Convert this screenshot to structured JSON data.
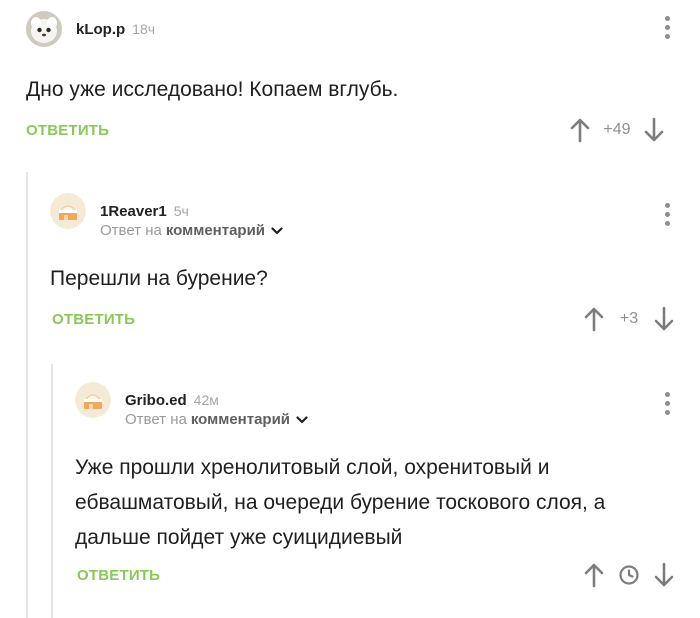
{
  "comments": [
    {
      "username": "kLop.p",
      "time": "18ч",
      "text": "Дно уже исследовано! Копаем вглубь.",
      "reply_label": "ОТВЕТИТЬ",
      "rating": "+49",
      "avatar": "fluffy-white-animal-avatar"
    },
    {
      "username": "1Reaver1",
      "time": "5ч",
      "reply_to_prefix": "Ответ на",
      "reply_to_target": "комментарий",
      "text": "Перешли на бурение?",
      "reply_label": "ОТВЕТИТЬ",
      "rating": "+3",
      "avatar": "cake-avatar"
    },
    {
      "username": "Gribo.ed",
      "time": "42м",
      "reply_to_prefix": "Ответ на",
      "reply_to_target": "комментарий",
      "text": "Уже прошли хренолитовый слой, охренитовый и ебвашматовый, на очереди бурение тоскового слоя, а дальше пойдет уже суицидиевый",
      "reply_label": "ОТВЕТИТЬ",
      "rating_icon": "clock-icon",
      "avatar": "cake-avatar"
    }
  ],
  "colors": {
    "accent_green": "#8ac858",
    "muted_gray": "#9a9a9a",
    "thread_line": "#e4e4e4"
  }
}
